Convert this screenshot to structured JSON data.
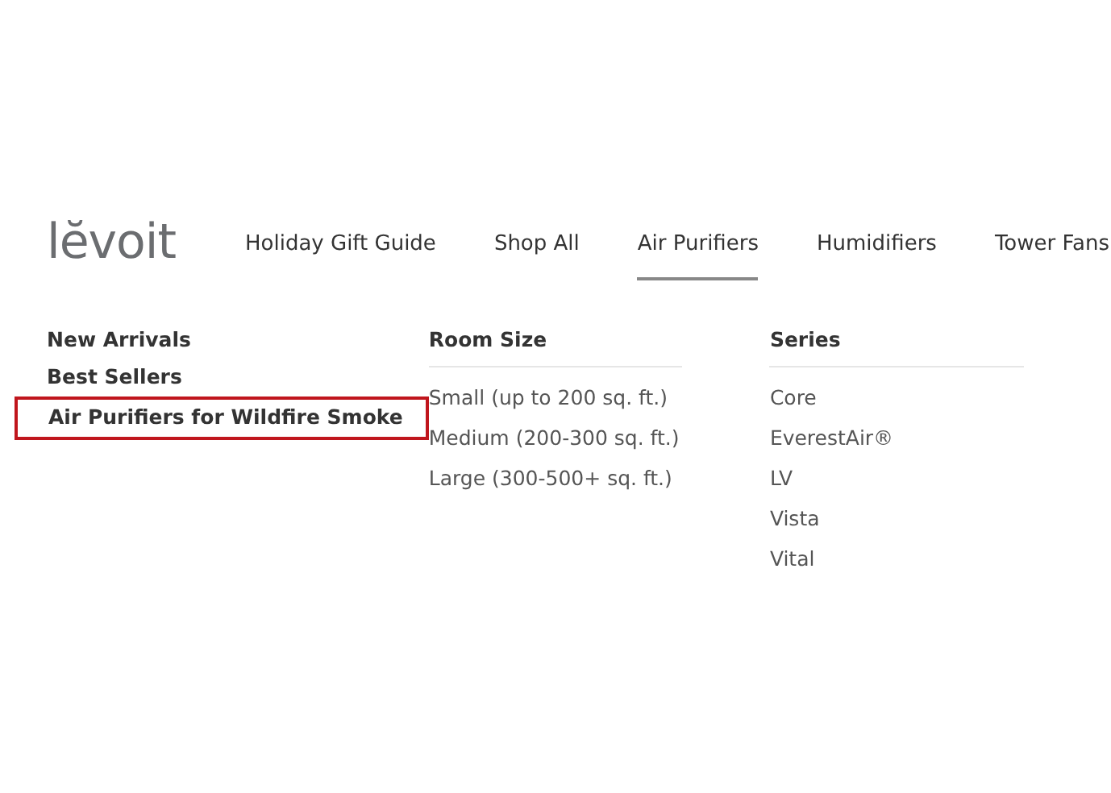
{
  "logo": "lĕvoit",
  "nav": [
    {
      "label": "Holiday Gift Guide",
      "selected": false
    },
    {
      "label": "Shop All",
      "selected": false
    },
    {
      "label": "Air Purifiers",
      "selected": true
    },
    {
      "label": "Humidifiers",
      "selected": false
    },
    {
      "label": "Tower Fans",
      "selected": false
    }
  ],
  "quick_links": [
    {
      "label": "New Arrivals",
      "highlighted": false
    },
    {
      "label": "Best Sellers",
      "highlighted": false
    },
    {
      "label": "Air Purifiers for Wildfire Smoke",
      "highlighted": true
    }
  ],
  "columns": [
    {
      "heading": "Room Size",
      "items": [
        "Small (up to 200 sq. ft.)",
        "Medium (200-300 sq. ft.)",
        "Large (300-500+ sq. ft.)"
      ]
    },
    {
      "heading": "Series",
      "items": [
        "Core",
        "EverestAir®",
        "LV",
        "Vista",
        "Vital"
      ]
    }
  ]
}
